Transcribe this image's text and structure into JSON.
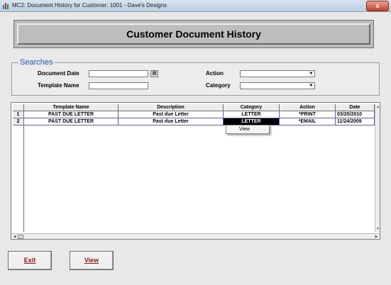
{
  "window": {
    "title": "MC2: Document History for Customer: 1001  -  Dave's Designs",
    "close_label": "x"
  },
  "header": {
    "title": "Customer Document History"
  },
  "searches": {
    "legend": "Searches",
    "document_date_label": "Document Date",
    "document_date_value": "",
    "template_name_label": "Template Name",
    "template_name_value": "",
    "action_label": "Action",
    "action_value": "",
    "category_label": "Category",
    "category_value": ""
  },
  "grid": {
    "columns": [
      "Template Name",
      "Description",
      "Category",
      "Action",
      "Date"
    ],
    "rows": [
      {
        "num": "1",
        "template_name": "PAST DUE LETTER",
        "description": "Past due Letter",
        "category": "LETTER",
        "action": "*PRINT",
        "date": "03/20/2010"
      },
      {
        "num": "2",
        "template_name": "PAST DUE LETTER",
        "description": "Past due Letter",
        "category": "LETTER",
        "action": "*EMAIL",
        "date": "11/24/2009"
      }
    ]
  },
  "context_menu": {
    "items": [
      "View"
    ]
  },
  "buttons": {
    "exit_label": "Exit",
    "view_label": "View"
  },
  "colors": {
    "accent_legend": "#2255bb",
    "button_text": "#8b1a1a",
    "row_selection": "#000000"
  }
}
